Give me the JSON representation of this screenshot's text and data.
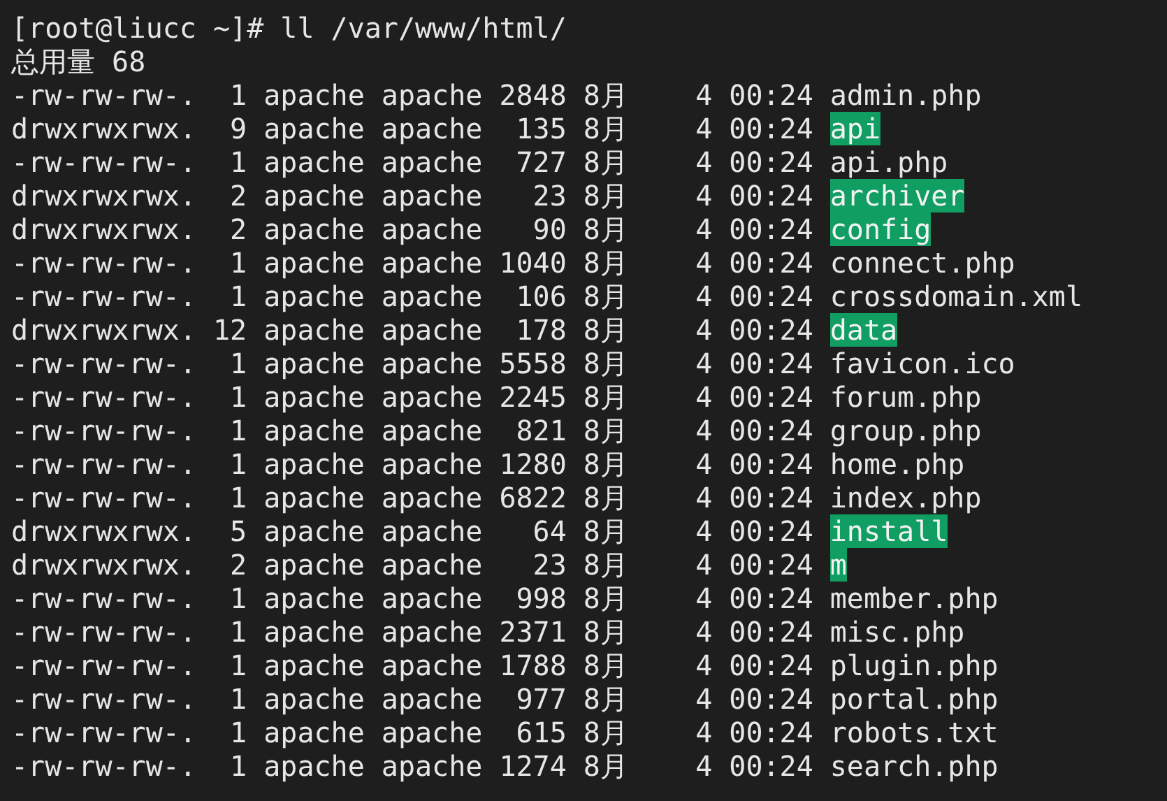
{
  "terminal": {
    "command_line": "[root@liucc ~]# ll /var/www/html/",
    "total_line": "总用量 68",
    "entries": [
      {
        "listing": "-rw-rw-rw-.  1 apache apache 2848 8月    4 00:24",
        "name": "admin.php",
        "kind": "file"
      },
      {
        "listing": "drwxrwxrwx.  9 apache apache  135 8月    4 00:24",
        "name": "api",
        "kind": "directory"
      },
      {
        "listing": "-rw-rw-rw-.  1 apache apache  727 8月    4 00:24",
        "name": "api.php",
        "kind": "file"
      },
      {
        "listing": "drwxrwxrwx.  2 apache apache   23 8月    4 00:24",
        "name": "archiver",
        "kind": "directory"
      },
      {
        "listing": "drwxrwxrwx.  2 apache apache   90 8月    4 00:24",
        "name": "config",
        "kind": "directory"
      },
      {
        "listing": "-rw-rw-rw-.  1 apache apache 1040 8月    4 00:24",
        "name": "connect.php",
        "kind": "file"
      },
      {
        "listing": "-rw-rw-rw-.  1 apache apache  106 8月    4 00:24",
        "name": "crossdomain.xml",
        "kind": "file"
      },
      {
        "listing": "drwxrwxrwx. 12 apache apache  178 8月    4 00:24",
        "name": "data",
        "kind": "directory"
      },
      {
        "listing": "-rw-rw-rw-.  1 apache apache 5558 8月    4 00:24",
        "name": "favicon.ico",
        "kind": "file"
      },
      {
        "listing": "-rw-rw-rw-.  1 apache apache 2245 8月    4 00:24",
        "name": "forum.php",
        "kind": "file"
      },
      {
        "listing": "-rw-rw-rw-.  1 apache apache  821 8月    4 00:24",
        "name": "group.php",
        "kind": "file"
      },
      {
        "listing": "-rw-rw-rw-.  1 apache apache 1280 8月    4 00:24",
        "name": "home.php",
        "kind": "file"
      },
      {
        "listing": "-rw-rw-rw-.  1 apache apache 6822 8月    4 00:24",
        "name": "index.php",
        "kind": "file"
      },
      {
        "listing": "drwxrwxrwx.  5 apache apache   64 8月    4 00:24",
        "name": "install",
        "kind": "directory"
      },
      {
        "listing": "drwxrwxrwx.  2 apache apache   23 8月    4 00:24",
        "name": "m",
        "kind": "directory"
      },
      {
        "listing": "-rw-rw-rw-.  1 apache apache  998 8月    4 00:24",
        "name": "member.php",
        "kind": "file"
      },
      {
        "listing": "-rw-rw-rw-.  1 apache apache 2371 8月    4 00:24",
        "name": "misc.php",
        "kind": "file"
      },
      {
        "listing": "-rw-rw-rw-.  1 apache apache 1788 8月    4 00:24",
        "name": "plugin.php",
        "kind": "file"
      },
      {
        "listing": "-rw-rw-rw-.  1 apache apache  977 8月    4 00:24",
        "name": "portal.php",
        "kind": "file"
      },
      {
        "listing": "-rw-rw-rw-.  1 apache apache  615 8月    4 00:24",
        "name": "robots.txt",
        "kind": "file"
      },
      {
        "listing": "-rw-rw-rw-.  1 apache apache 1274 8月    4 00:24",
        "name": "search.php",
        "kind": "file"
      }
    ]
  }
}
